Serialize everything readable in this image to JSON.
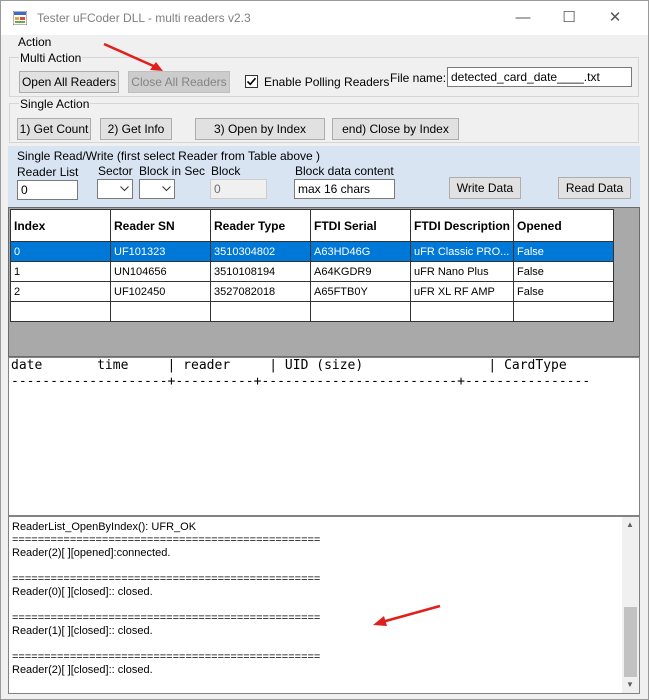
{
  "window": {
    "title": "Tester uFCoder DLL - multi readers v2.3",
    "controls": {
      "minimize": "—",
      "maximize": "☐",
      "close": "✕"
    }
  },
  "action": {
    "label": "Action",
    "multi": {
      "label": "Multi Action",
      "open_all": "Open All Readers",
      "close_all": "Close All Readers",
      "polling_label": "Enable Polling Readers",
      "polling_checked": true,
      "file_name_label": "File name:",
      "file_name_value": "detected_card_date____.txt"
    },
    "single": {
      "label": "Single Action",
      "get_count": "1) Get Count",
      "get_info": "2) Get Info",
      "open_by_index": "3) Open by Index",
      "close_by_index": "end) Close by Index"
    }
  },
  "read_write": {
    "title": "Single Read/Write  (first select Reader from Table above )",
    "reader_list_label": "Reader List",
    "reader_list_value": "0",
    "sector_label": "Sector",
    "block_in_sec_label": "Block in Sec",
    "block_label": "Block",
    "block_value": "0",
    "block_data_label": "Block data content",
    "block_data_value": "max 16 chars",
    "write_button": "Write Data",
    "read_button": "Read Data"
  },
  "grid": {
    "headers": [
      "Index",
      "Reader SN",
      "Reader Type",
      "FTDI Serial",
      "FTDI Description",
      "Opened"
    ],
    "rows": [
      [
        "0",
        "UF101323",
        "3510304802",
        "A63HD46G",
        "uFR Classic PRO...",
        "False"
      ],
      [
        "1",
        "UN104656",
        "3510108194",
        "A64KGDR9",
        "uFR Nano Plus",
        "False"
      ],
      [
        "2",
        "UF102450",
        "3527082018",
        "A65FTB0Y",
        "uFR XL RF AMP",
        "False"
      ]
    ],
    "selected_row": 0
  },
  "card_log": {
    "header": "date       time     | reader     | UID (size)                | CardType",
    "separator": "--------------------+----------+-------------------------+----------------"
  },
  "status_log": {
    "lines": [
      "ReaderList_OpenByIndex(): UFR_OK",
      "================================================",
      "Reader(2)[ ][opened]:connected.",
      "",
      "================================================",
      "Reader(0)[ ][closed]:: closed.",
      "",
      "================================================",
      "Reader(1)[ ][closed]:: closed.",
      "",
      "================================================",
      "Reader(2)[ ][closed]:: closed."
    ]
  },
  "colors": {
    "selection": "#0078d7",
    "panel_blue": "#d8e4f2",
    "annotation_arrow": "#e0201c"
  }
}
